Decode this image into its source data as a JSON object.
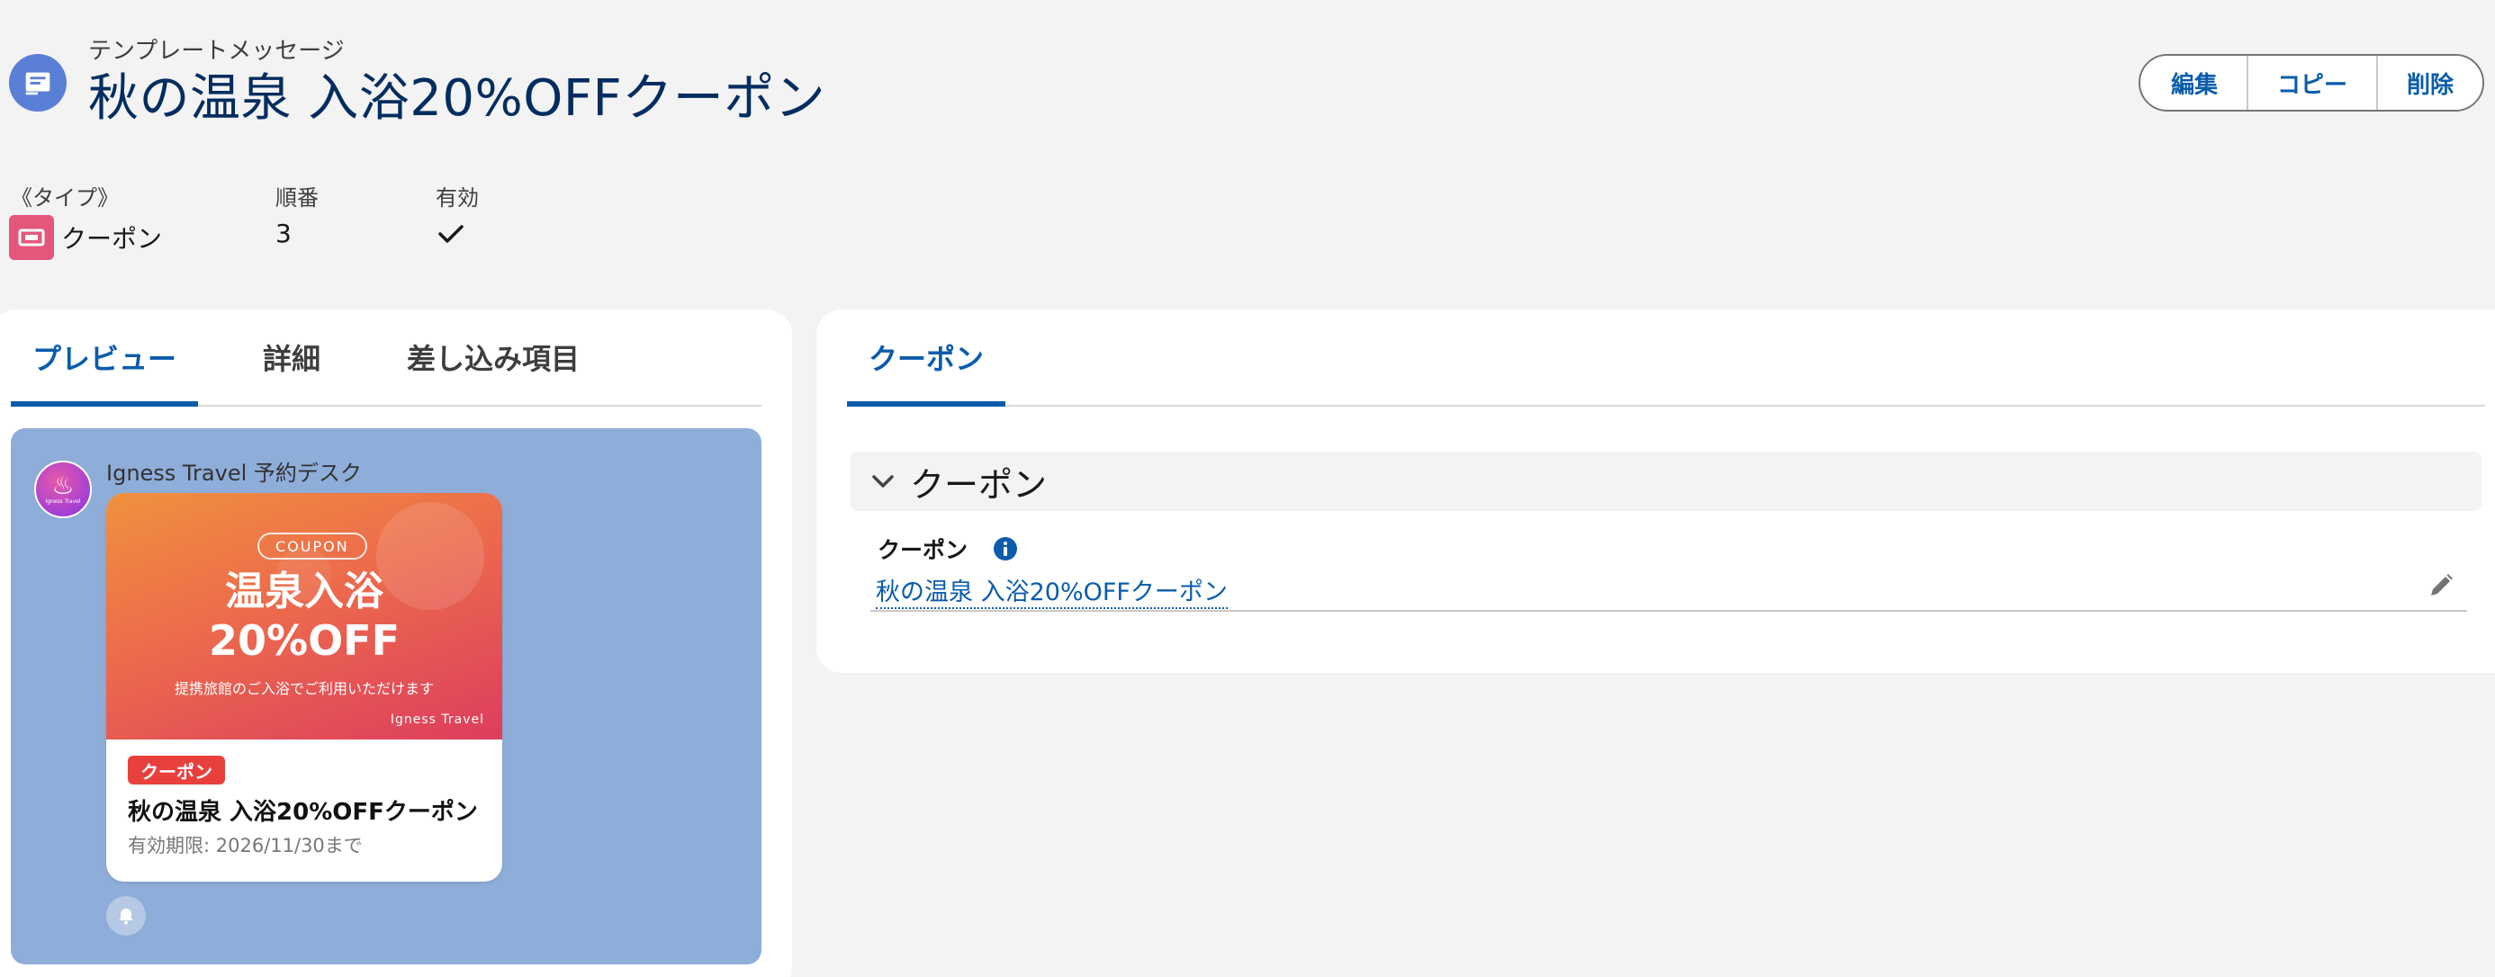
{
  "header": {
    "object_label": "テンプレートメッセージ",
    "title": "秋の温泉 入浴20%OFFクーポン",
    "buttons": {
      "edit": "編集",
      "copy": "コピー",
      "delete": "削除"
    }
  },
  "highlights": {
    "type_label": "《タイプ》",
    "type_value": "クーポン",
    "order_label": "順番",
    "order_value": "3",
    "active_label": "有効",
    "active_checked": true
  },
  "left_tabs": [
    {
      "label": "プレビュー",
      "active": true
    },
    {
      "label": "詳細",
      "active": false
    },
    {
      "label": "差し込み項目",
      "active": false
    }
  ],
  "preview": {
    "background_color": "#8eadd9",
    "sender_name": "Igness Travel 予約デスク",
    "avatar_text": "Igness Travel",
    "coupon": {
      "pill": "COUPON",
      "headline_1": "温泉入浴",
      "headline_2": "20%OFF",
      "subtext": "提携旅館のご入浴でご利用いただけます",
      "brand": "Igness Travel",
      "tag": "クーポン",
      "title": "秋の温泉 入浴20%OFFクーポン",
      "expiry": "有効期限: 2026/11/30まで"
    }
  },
  "right_tabs": [
    {
      "label": "クーポン",
      "active": true
    }
  ],
  "section": {
    "title": "クーポン",
    "field_label": "クーポン",
    "field_value": "秋の温泉 入浴20%OFFクーポン"
  },
  "colors": {
    "brand_blue": "#0b5cab",
    "title_navy": "#032d60",
    "coupon_red": "#e8403c",
    "type_badge": "#e3577b"
  },
  "icons": [
    "template-icon",
    "coupon-type-icon",
    "checkmark-icon",
    "onsen-avatar-icon",
    "bell-icon",
    "chevron-down-icon",
    "info-icon",
    "pencil-icon"
  ]
}
